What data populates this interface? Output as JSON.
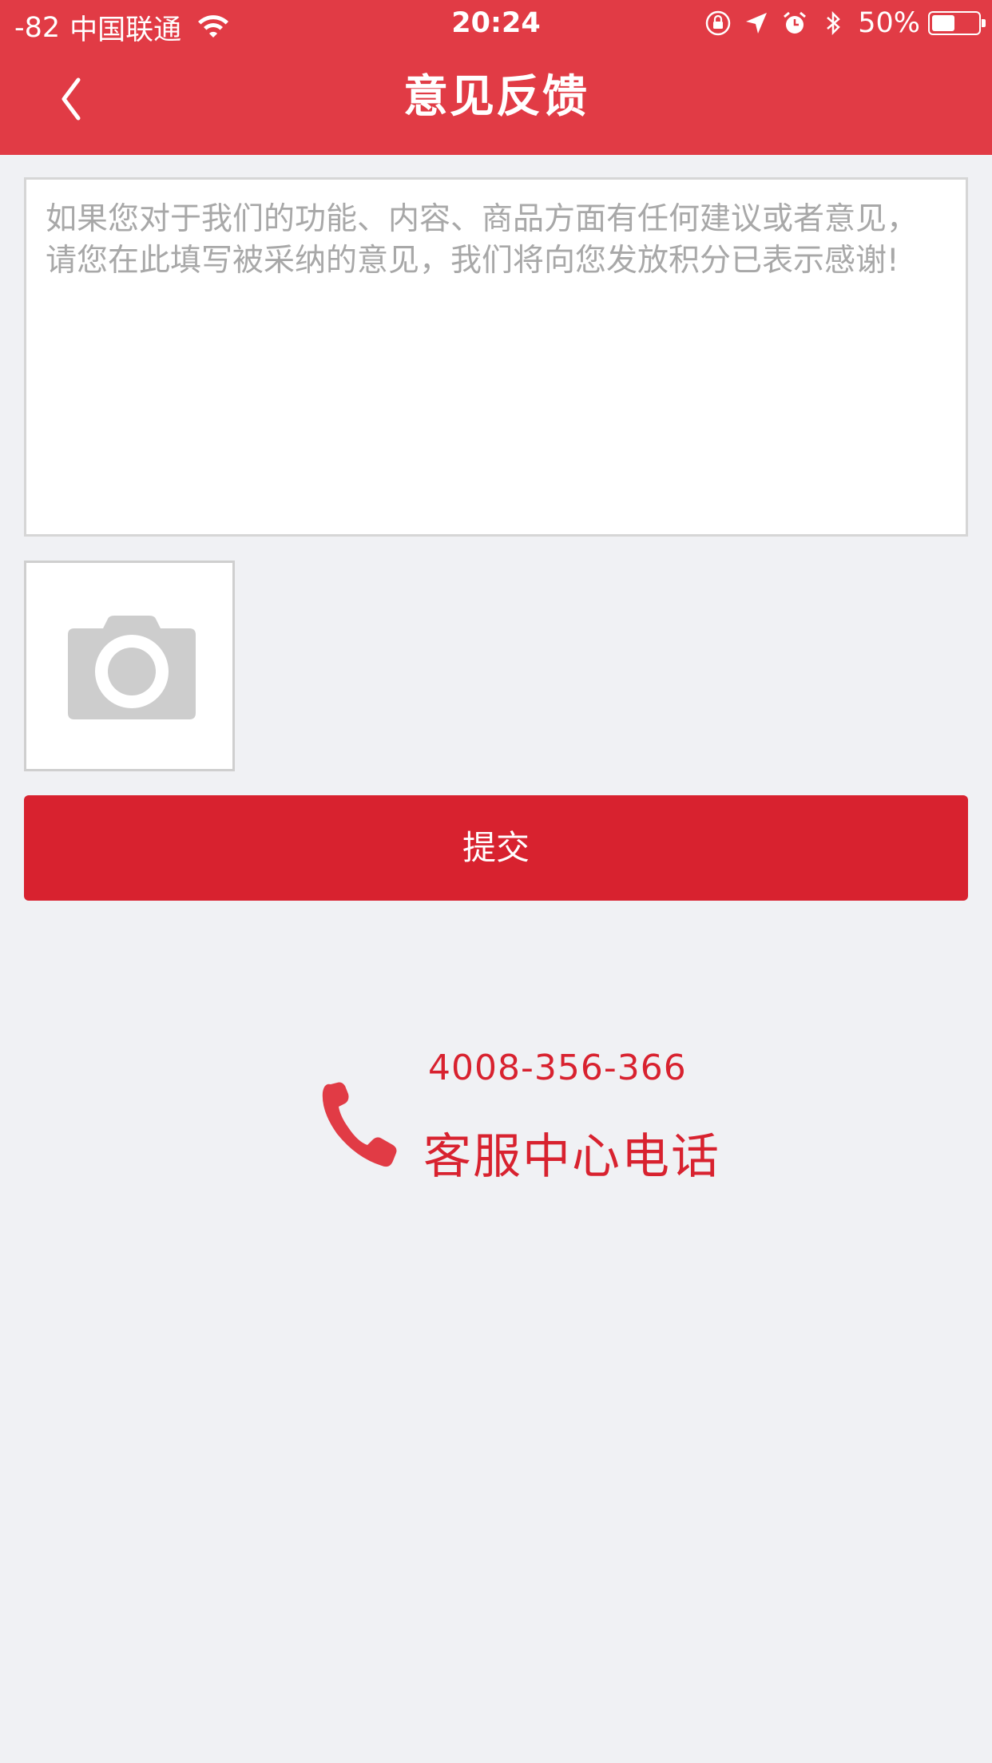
{
  "status_bar": {
    "signal": "-82",
    "carrier": "中国联通",
    "time": "20:24",
    "battery_text": "50%",
    "battery_level": 0.5
  },
  "header": {
    "title": "意见反馈",
    "back_icon": "chevron-left-icon"
  },
  "feedback": {
    "value": "",
    "placeholder": "如果您对于我们的功能、内容、商品方面有任何建议或者意见，请您在此填写被采纳的意见，我们将向您发放积分已表示感谢!"
  },
  "photo": {
    "icon": "camera-icon"
  },
  "submit": {
    "label": "提交"
  },
  "customer_service": {
    "phone_number": "4008-356-366",
    "label": "客服中心电话",
    "icon": "phone-icon"
  },
  "colors": {
    "header_bg": "#e13b45",
    "accent": "#d8222f",
    "page_bg": "#f0f1f4"
  }
}
